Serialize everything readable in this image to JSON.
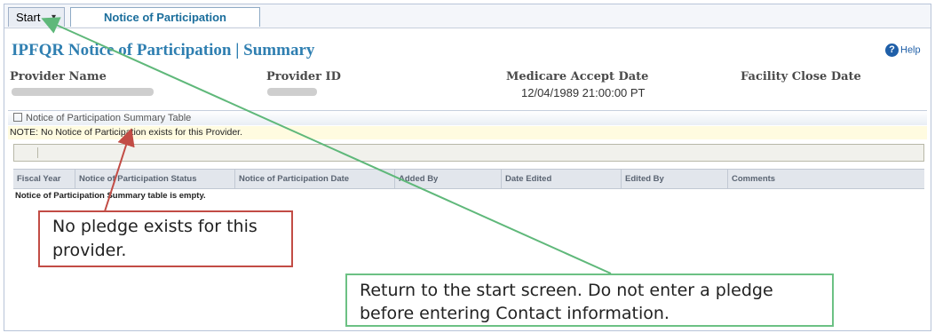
{
  "tabs": {
    "start": "Start",
    "notice": "Notice of Participation"
  },
  "header": {
    "title": "IPFQR Notice of Participation | Summary",
    "help": "Help"
  },
  "provider": {
    "name_label": "Provider Name",
    "id_label": "Provider ID",
    "medicare_label": "Medicare Accept Date",
    "medicare_value": "12/04/1989 21:00:00 PT",
    "close_label": "Facility Close Date"
  },
  "section": {
    "title": "Notice of Participation Summary Table",
    "note": "NOTE: No Notice of Participation exists for this Provider."
  },
  "table": {
    "columns": [
      "Fiscal Year",
      "Notice of Participation Status",
      "Notice of Participation Date",
      "Added By",
      "Date Edited",
      "Edited By",
      "Comments"
    ],
    "empty_message": "Notice of Participation Summary table is empty."
  },
  "callouts": {
    "no_pledge": "No pledge exists for this provider.",
    "return": "Return to the start screen. Do not enter a pledge before entering Contact information."
  },
  "colors": {
    "accent": "#2f7fb1",
    "red_callout": "#c24c45",
    "green_callout": "#6cc184"
  }
}
